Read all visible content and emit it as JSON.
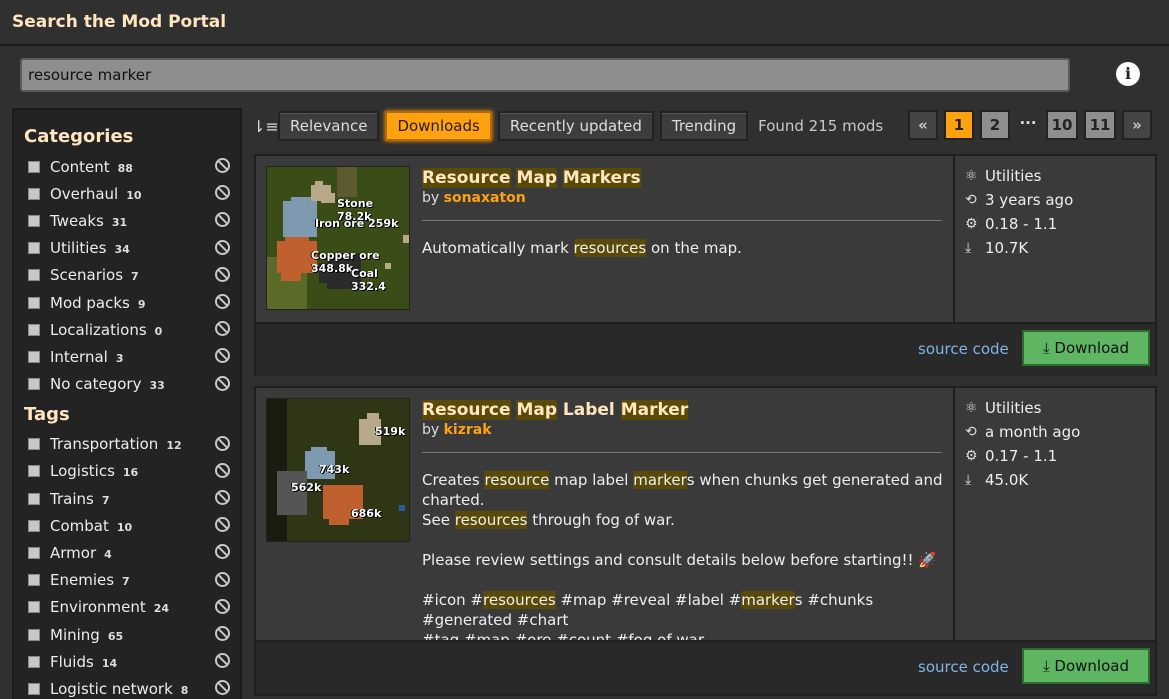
{
  "page_title": "Search the Mod Portal",
  "search": {
    "value": "resource marker"
  },
  "info_icon": "i",
  "sidebar": {
    "categories_heading": "Categories",
    "categories": [
      {
        "label": "Content",
        "count": "88"
      },
      {
        "label": "Overhaul",
        "count": "10"
      },
      {
        "label": "Tweaks",
        "count": "31"
      },
      {
        "label": "Utilities",
        "count": "34"
      },
      {
        "label": "Scenarios",
        "count": "7"
      },
      {
        "label": "Mod packs",
        "count": "9"
      },
      {
        "label": "Localizations",
        "count": "0"
      },
      {
        "label": "Internal",
        "count": "3"
      },
      {
        "label": "No category",
        "count": "33"
      }
    ],
    "tags_heading": "Tags",
    "tags": [
      {
        "label": "Transportation",
        "count": "12"
      },
      {
        "label": "Logistics",
        "count": "16"
      },
      {
        "label": "Trains",
        "count": "7"
      },
      {
        "label": "Combat",
        "count": "10"
      },
      {
        "label": "Armor",
        "count": "4"
      },
      {
        "label": "Enemies",
        "count": "7"
      },
      {
        "label": "Environment",
        "count": "24"
      },
      {
        "label": "Mining",
        "count": "65"
      },
      {
        "label": "Fluids",
        "count": "14"
      },
      {
        "label": "Logistic network",
        "count": "8"
      }
    ]
  },
  "sort": {
    "buttons": [
      "Relevance",
      "Downloads",
      "Recently updated",
      "Trending"
    ],
    "active": "Downloads",
    "found": "Found 215 mods"
  },
  "pager": {
    "pages": [
      "1",
      "2",
      "10",
      "11"
    ],
    "current": "1",
    "dots": "···"
  },
  "mods": [
    {
      "title_parts": [
        "Resource",
        " ",
        "Map",
        " ",
        "Markers"
      ],
      "by": "by",
      "author": "sonaxaton",
      "desc": [
        "Automatically mark ",
        "resources",
        " on the map."
      ],
      "thumb_labels": [
        "Stone 78.2k",
        "Iron ore 259k",
        "Copper ore 348.8k",
        "Coal 332.4"
      ],
      "category": "Utilities",
      "updated": "3 years ago",
      "version": "0.18 - 1.1",
      "downloads": "10.7K",
      "source": "source code",
      "download": "Download"
    },
    {
      "title_parts": [
        "Resource",
        " ",
        "Map",
        " ",
        "Label",
        " ",
        "Marker"
      ],
      "by": "by",
      "author": "kizrak",
      "desc1": [
        "Creates ",
        "resource",
        " map label ",
        "marker",
        "s when chunks get generated and charted."
      ],
      "desc2": [
        "See ",
        "resources",
        " through fog of war."
      ],
      "desc3": "Please review settings and consult details below before starting!! 🚀",
      "desc4": [
        "#icon #",
        "resources",
        " #map #reveal #label #",
        "marker",
        "s #chunks #generated #chart"
      ],
      "desc5": "#tag #map #ore #count #fog of war",
      "thumb_labels": [
        "519k",
        "743k",
        "562k",
        "686k"
      ],
      "category": "Utilities",
      "updated": "a month ago",
      "version": "0.17 - 1.1",
      "downloads": "45.0K",
      "source": "source code",
      "download": "Download"
    }
  ]
}
